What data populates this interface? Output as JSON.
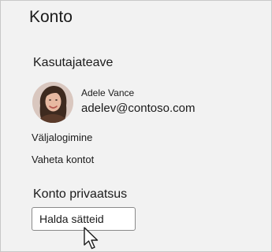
{
  "panel": {
    "title": "Konto"
  },
  "user_info": {
    "heading": "Kasutajateave",
    "name": "Adele Vance",
    "email": "adelev@contoso.com"
  },
  "actions": {
    "sign_out_label": "Väljalogimine",
    "switch_account_label": "Vaheta kontot"
  },
  "privacy": {
    "heading": "Konto privaatsus",
    "manage_settings_label": "Halda sätteid"
  },
  "icons": {
    "avatar": "user-avatar-photo",
    "cursor": "mouse-pointer-icon"
  },
  "colors": {
    "panel_background": "#f2f2f2",
    "panel_border": "#c8c8c8",
    "button_background": "#ffffff",
    "button_border": "#8a8a8a",
    "text": "#1b1b1b"
  }
}
